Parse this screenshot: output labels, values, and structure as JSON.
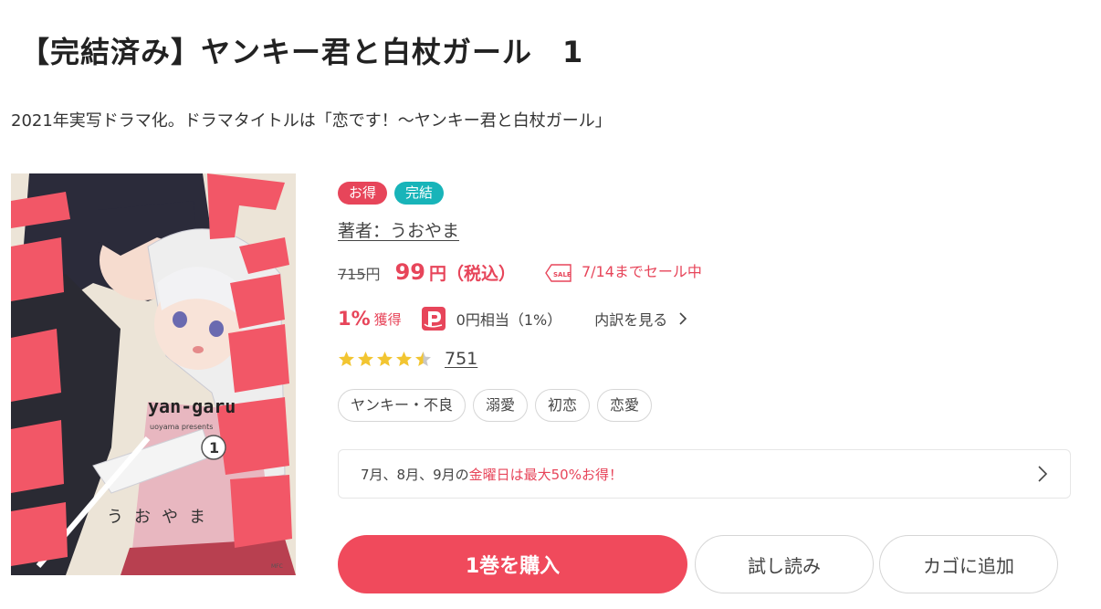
{
  "product": {
    "title": "【完結済み】ヤンキー君と白杖ガール　1",
    "subtitle": "2021年実写ドラマ化。ドラマタイトルは「恋です！〜ヤンキー君と白杖ガール」"
  },
  "cover": {
    "title_text": "ヤンキー君と白杖ガール",
    "logo_text": "yan-garu",
    "volume": "1",
    "author_text": "うおやま",
    "credit_text": "uoyama presents",
    "publisher_text": "MFC"
  },
  "badges": {
    "sale": "お得",
    "completed": "完結"
  },
  "author": {
    "label": "著者：うおやま"
  },
  "price": {
    "original": "715",
    "original_unit": "円",
    "current": "99",
    "current_unit": "円（税込）",
    "sale_icon_text": "SALE",
    "sale_note": "7/14までセール中"
  },
  "points": {
    "percent": "1%",
    "label": "獲得",
    "icon_text": "P",
    "equivalent": "0円相当（1%）",
    "breakdown": "内訳を見る"
  },
  "rating": {
    "value": 4.5,
    "max": 5,
    "count": "751"
  },
  "tags": [
    "ヤンキー・不良",
    "溺愛",
    "初恋",
    "恋愛"
  ],
  "campaign": {
    "text_before": "7月、8月、9月の",
    "highlight": "金曜日は最大50%お得！"
  },
  "buttons": {
    "buy": "1巻を購入",
    "trial": "試し読み",
    "cart": "カゴに追加"
  },
  "colors": {
    "accent": "#e7455a",
    "teal": "#18b4b9",
    "star": "#f2c531"
  },
  "icons": {
    "sale": "sale-tag-icon",
    "point": "point-icon",
    "breakdown_arrow": "chevron-right-icon",
    "campaign_arrow": "chevron-right-icon",
    "star": "star-icon"
  }
}
